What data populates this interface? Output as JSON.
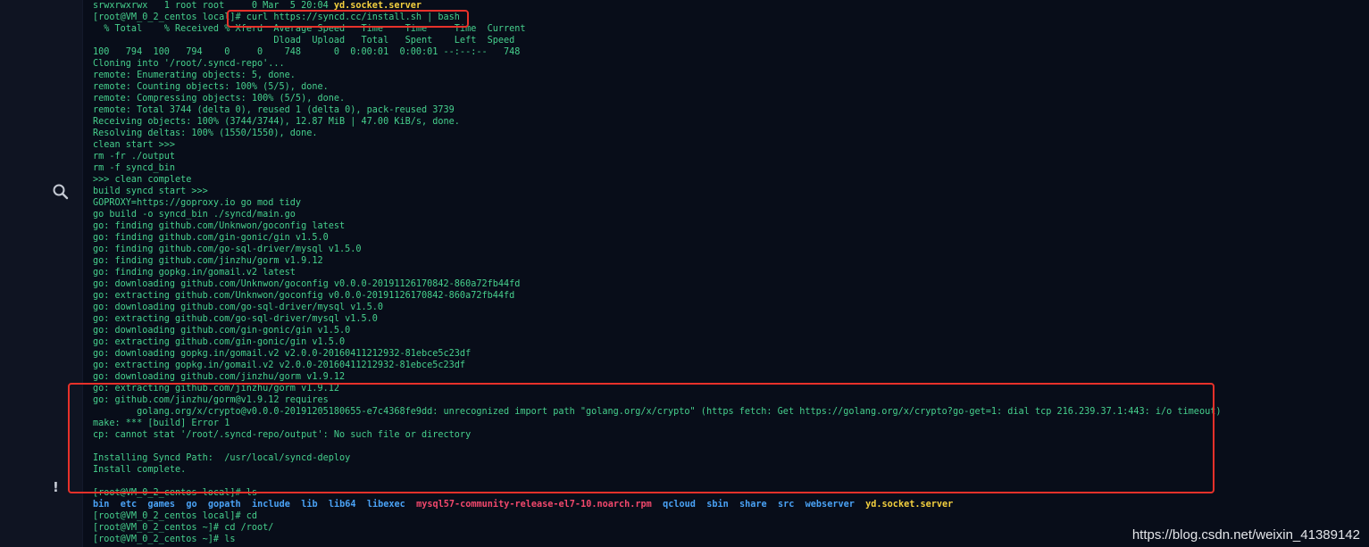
{
  "terminal": {
    "top_line": "srwxrwxrwx   1 root root     0 Mar  5 20:04 ",
    "top_file": "yd.socket.server",
    "prompt_local": "[root@VM_0_2_centos local]",
    "command": "# curl https://syncd.cc/install.sh | bash",
    "lines": [
      "  % Total    % Received % Xferd  Average Speed   Time    Time     Time  Current",
      "                                 Dload  Upload   Total   Spent    Left  Speed",
      "100   794  100   794    0     0    748      0  0:00:01  0:00:01 --:--:--   748",
      "Cloning into '/root/.syncd-repo'...",
      "remote: Enumerating objects: 5, done.",
      "remote: Counting objects: 100% (5/5), done.",
      "remote: Compressing objects: 100% (5/5), done.",
      "remote: Total 3744 (delta 0), reused 1 (delta 0), pack-reused 3739",
      "Receiving objects: 100% (3744/3744), 12.87 MiB | 47.00 KiB/s, done.",
      "Resolving deltas: 100% (1550/1550), done.",
      "clean start >>>",
      "rm -fr ./output",
      "rm -f syncd_bin",
      ">>> clean complete",
      "build syncd start >>>",
      "GOPROXY=https://goproxy.io go mod tidy",
      "go build -o syncd_bin ./syncd/main.go",
      "go: finding github.com/Unknwon/goconfig latest",
      "go: finding github.com/gin-gonic/gin v1.5.0",
      "go: finding github.com/go-sql-driver/mysql v1.5.0",
      "go: finding github.com/jinzhu/gorm v1.9.12",
      "go: finding gopkg.in/gomail.v2 latest",
      "go: downloading github.com/Unknwon/goconfig v0.0.0-20191126170842-860a72fb44fd",
      "go: extracting github.com/Unknwon/goconfig v0.0.0-20191126170842-860a72fb44fd",
      "go: downloading github.com/go-sql-driver/mysql v1.5.0",
      "go: extracting github.com/go-sql-driver/mysql v1.5.0",
      "go: downloading github.com/gin-gonic/gin v1.5.0",
      "go: extracting github.com/gin-gonic/gin v1.5.0",
      "go: downloading gopkg.in/gomail.v2 v2.0.0-20160411212932-81ebce5c23df",
      "go: extracting gopkg.in/gomail.v2 v2.0.0-20160411212932-81ebce5c23df",
      "go: downloading github.com/jinzhu/gorm v1.9.12",
      "go: extracting github.com/jinzhu/gorm v1.9.12",
      "go: github.com/jinzhu/gorm@v1.9.12 requires",
      "        golang.org/x/crypto@v0.0.0-20191205180655-e7c4368fe9dd: unrecognized import path \"golang.org/x/crypto\" (https fetch: Get https://golang.org/x/crypto?go-get=1: dial tcp 216.239.37.1:443: i/o timeout)",
      "make: *** [build] Error 1",
      "cp: cannot stat '/root/.syncd-repo/output': No such file or directory",
      "",
      "Installing Syncd Path:  /usr/local/syncd-deploy",
      "Install complete.",
      "",
      "[root@VM_0_2_centos local]# ls"
    ],
    "ls_dirs": [
      "bin",
      "etc",
      "games",
      "go",
      "gopath",
      "include",
      "lib",
      "lib64",
      "libexec"
    ],
    "ls_rpm": "mysql57-community-release-el7-10.noarch.rpm",
    "ls_dirs2": [
      "qcloud",
      "sbin",
      "share",
      "src",
      "webserver"
    ],
    "ls_socket": "yd.socket.server",
    "tail": [
      "[root@VM_0_2_centos local]# cd",
      "[root@VM_0_2_centos ~]# cd /root/",
      "[root@VM_0_2_centos ~]# ls"
    ]
  },
  "watermark": "https://blog.csdn.net/weixin_41389142",
  "colors": {
    "background": "#080d19",
    "text": "#46d08d",
    "directory": "#4aa2f5",
    "rpm": "#f2486c",
    "socket": "#f4d03f",
    "highlight": "#e7312a"
  },
  "icons": {
    "sidebar_search": "search-icon",
    "sidebar_alert": "exclamation-icon"
  }
}
